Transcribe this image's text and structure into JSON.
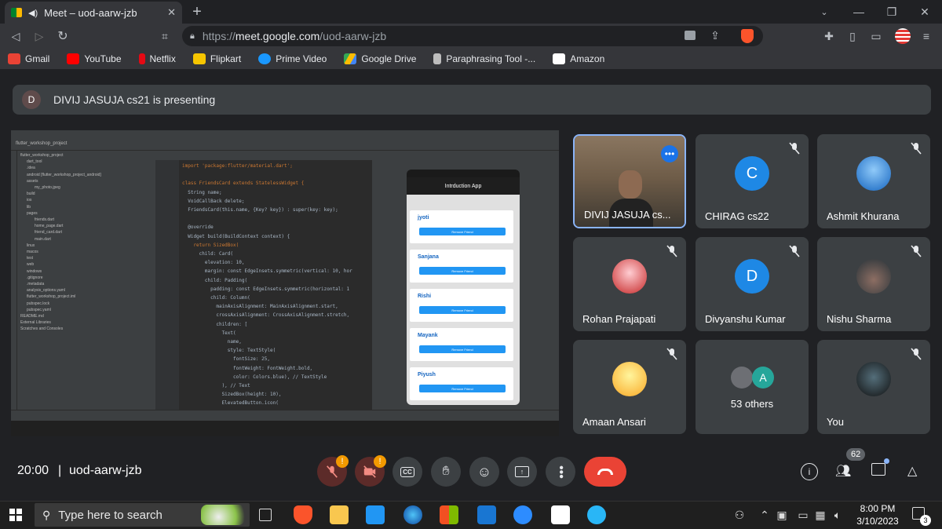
{
  "browser": {
    "tab_title": "Meet – uod-aarw-jzb",
    "url_prefix": "https://",
    "url_host": "meet.google.com",
    "url_path": "/uod-aarw-jzb",
    "bookmarks": [
      {
        "label": "Gmail",
        "color": "#ea4335"
      },
      {
        "label": "YouTube",
        "color": "#ff0000"
      },
      {
        "label": "Netflix",
        "color": "#e50914"
      },
      {
        "label": "Flipkart",
        "color": "#f7c600"
      },
      {
        "label": "Prime Video",
        "color": "#1a98ff"
      },
      {
        "label": "Google Drive",
        "color": "#34a853"
      },
      {
        "label": "Paraphrasing Tool -...",
        "color": "#bdbdbd"
      },
      {
        "label": "Amazon",
        "color": "#ffffff"
      }
    ]
  },
  "meet": {
    "presenter_initial": "D",
    "presenting_text": "DIVIJ JASUJA cs21 is presenting",
    "time": "20:00",
    "meeting_code": "uod-aarw-jzb",
    "participant_count": "62",
    "participants": [
      {
        "name": "DIVIJ JASUJA cs...",
        "kind": "video"
      },
      {
        "name": "CHIRAG cs22",
        "initial": "C",
        "color": "#1e88e5"
      },
      {
        "name": "Ashmit Khurana",
        "kind": "photo"
      },
      {
        "name": "Rohan Prajapati",
        "kind": "photo"
      },
      {
        "name": "Divyanshu Kumar",
        "initial": "D",
        "color": "#1e88e5"
      },
      {
        "name": "Nishu Sharma",
        "kind": "photo"
      },
      {
        "name": "Amaan Ansari",
        "kind": "photo"
      },
      {
        "name": "53 others",
        "initial": "A",
        "color": "#26a69a"
      },
      {
        "name": "You",
        "kind": "photo"
      }
    ]
  },
  "shared_screen": {
    "app_title": "Intrduction App",
    "project": "flutter_workshop_project",
    "names": [
      "jyoti",
      "Sanjana",
      "Rishi",
      "Mayank",
      "Piyush"
    ],
    "remove_label": "Remove Friend",
    "code": [
      "import 'package:flutter/material.dart';",
      "",
      "class FriendsCard extends StatelessWidget {",
      "  String name;",
      "  VoidCallBack delete;",
      "  FriendsCard(this.name, {Key? key}) : super(key: key);",
      "",
      "  @override",
      "  Widget build(BuildContext context) {",
      "    return SizedBox(",
      "      child: Card(",
      "        elevation: 10,",
      "        margin: const EdgeInsets.symmetric(vertical: 10, hor",
      "        child: Padding(",
      "          padding: const EdgeInsets.symmetric(horizontal: 1",
      "          child: Column(",
      "            mainAxisAlignment: MainAxisAlignment.start,",
      "            crossAxisAlignment: CrossAxisAlignment.stretch,",
      "            children: [",
      "              Text(",
      "                name,",
      "                style: TextStyle(",
      "                  fontSize: 25,",
      "                  fontWeight: FontWeight.bold,",
      "                  color: Colors.blue), // TextStyle",
      "              ), // Text",
      "              SizedBox(height: 10),",
      "              ElevatedButton.icon("
    ],
    "files": [
      "flutter_workshop_project",
      "dart_tool",
      ".idea",
      "android [flutter_workshop_project_android]",
      "assets",
      "my_photo.jpeg",
      "build",
      "ios",
      "lib",
      "pages",
      "friends.dart",
      "home_page.dart",
      "friend_card.dart",
      "main.dart",
      "linux",
      "macos",
      "test",
      "web",
      "windows",
      ".gitignore",
      ".metadata",
      "analysis_options.yaml",
      "flutter_workshop_project.iml",
      "pubspec.lock",
      "pubspec.yaml",
      "README.md",
      "External Libraries",
      "Scratches and Consoles"
    ]
  },
  "taskbar": {
    "search_placeholder": "Type here to search",
    "time": "8:00 PM",
    "date": "3/10/2023",
    "notification_count": "3"
  }
}
